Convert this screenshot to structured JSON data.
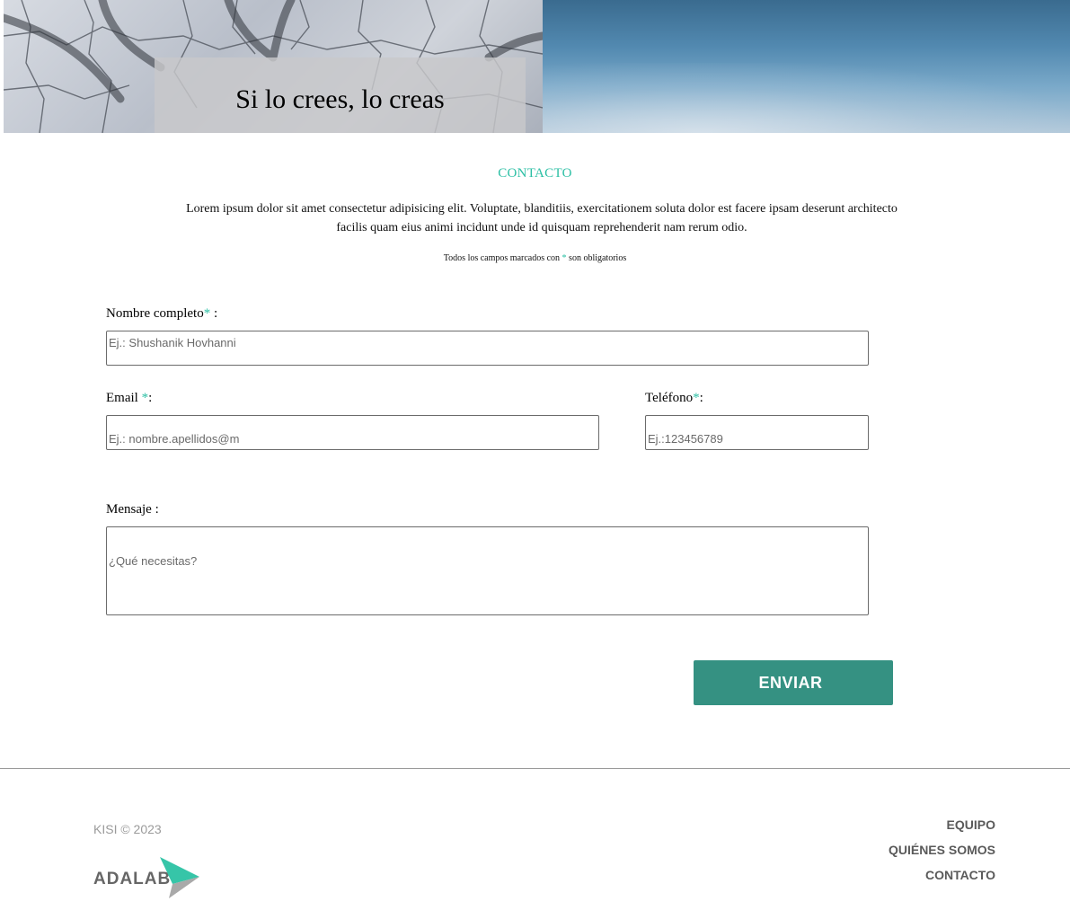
{
  "hero": {
    "title": "Si lo crees, lo creas"
  },
  "contact": {
    "section_title": "CONTACTO",
    "intro": "Lorem ipsum dolor sit amet consectetur adipisicing elit. Voluptate, blanditiis, exercitationem soluta dolor est facere ipsam deserunt architecto facilis quam eius animi incidunt unde id quisquam reprehenderit nam rerum odio.",
    "required_note_before": "Todos los campos marcados con ",
    "required_note_asterisk": "*",
    "required_note_after": " son obligatorios"
  },
  "form": {
    "name": {
      "label": "Nombre completo",
      "suffix": " :",
      "required_mark": "*",
      "placeholder": "Ej.: Shushanik Hovhanni"
    },
    "email": {
      "label": "Email ",
      "suffix": ":",
      "required_mark": "*",
      "placeholder": "Ej.: nombre.apellidos@m"
    },
    "phone": {
      "label": "Teléfono",
      "suffix": ":",
      "required_mark": "*",
      "placeholder": "Ej.:123456789"
    },
    "message": {
      "label": "Mensaje :",
      "placeholder": "¿Qué necesitas?"
    },
    "submit_label": "ENVIAR"
  },
  "footer": {
    "copyright": "KISI © 2023",
    "logo_text": "ADALAB",
    "nav": [
      {
        "label": "EQUIPO"
      },
      {
        "label": "QUIÉNES SOMOS"
      },
      {
        "label": "CONTACTO"
      }
    ]
  },
  "colors": {
    "accent": "#2bbfa4",
    "button": "#359182",
    "footer_text": "#5a5a5a"
  }
}
